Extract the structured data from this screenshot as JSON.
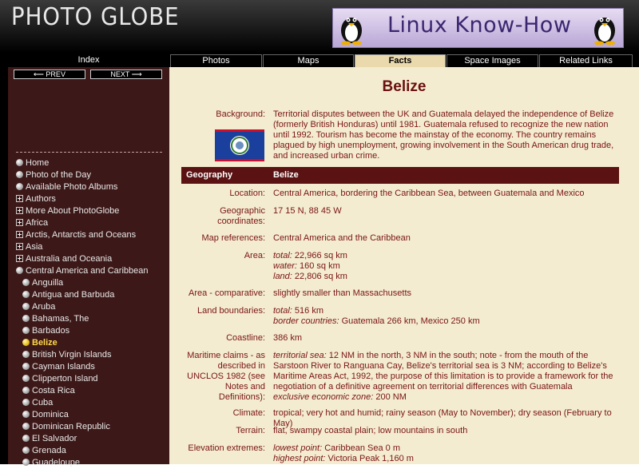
{
  "header": {
    "logo_text": "PHOTO GLOBE",
    "banner_text": "Linux Know-How"
  },
  "nav": {
    "index_label": "Index",
    "prev_label": "⟵ PREV",
    "next_label": "NEXT ⟶",
    "tabs": [
      "Photos",
      "Maps",
      "Facts",
      "Space Images",
      "Related Links"
    ],
    "active_tab": "Facts"
  },
  "sidebar": {
    "items": [
      {
        "label": "Home",
        "marker": "dot"
      },
      {
        "label": "Photo of the Day",
        "marker": "dot"
      },
      {
        "label": "Available Photo Albums",
        "marker": "dot"
      },
      {
        "label": "Authors",
        "marker": "plus"
      },
      {
        "label": "More About PhotoGlobe",
        "marker": "plus"
      },
      {
        "label": "Africa",
        "marker": "plus"
      },
      {
        "label": "Arctis, Antarctis and Oceans",
        "marker": "plus"
      },
      {
        "label": "Asia",
        "marker": "plus"
      },
      {
        "label": "Australia and Oceania",
        "marker": "plus"
      },
      {
        "label": "Central America and Caribbean",
        "marker": "dot"
      },
      {
        "label": "Anguilla",
        "marker": "dot"
      },
      {
        "label": "Antigua and Barbuda",
        "marker": "dot"
      },
      {
        "label": "Aruba",
        "marker": "dot"
      },
      {
        "label": "Bahamas, The",
        "marker": "dot"
      },
      {
        "label": "Barbados",
        "marker": "dot"
      },
      {
        "label": "Belize",
        "marker": "dot"
      },
      {
        "label": "British Virgin Islands",
        "marker": "dot"
      },
      {
        "label": "Cayman Islands",
        "marker": "dot"
      },
      {
        "label": "Clipperton Island",
        "marker": "dot"
      },
      {
        "label": "Costa Rica",
        "marker": "dot"
      },
      {
        "label": "Cuba",
        "marker": "dot"
      },
      {
        "label": "Dominica",
        "marker": "dot"
      },
      {
        "label": "Dominican Republic",
        "marker": "dot"
      },
      {
        "label": "El Salvador",
        "marker": "dot"
      },
      {
        "label": "Grenada",
        "marker": "dot"
      },
      {
        "label": "Guadeloupe",
        "marker": "dot"
      }
    ],
    "current_item": "Belize"
  },
  "content": {
    "title": "Belize",
    "background_label": "Background:",
    "background_text": "Territorial disputes between the UK and Guatemala delayed the independence of Belize (formerly British Honduras) until 1981. Guatemala refused to recognize the new nation until 1992. Tourism has become the mainstay of the economy. The country remains plagued by high unemployment, growing involvement in the South American drug trade, and increased urban crime.",
    "section_label": "Geography",
    "section_value": "Belize",
    "location_label": "Location:",
    "location": "Central America, bordering the Caribbean Sea, between Guatemala and Mexico",
    "coords_label": "Geographic coordinates:",
    "coords": "17 15 N, 88 45 W",
    "mapref_label": "Map references:",
    "mapref": "Central America and the Caribbean",
    "area_label": "Area:",
    "area_total_k": "total:",
    "area_total": " 22,966 sq km",
    "area_water_k": "water:",
    "area_water": " 160 sq km",
    "area_land_k": "land:",
    "area_land": " 22,806 sq km",
    "areacomp_label": "Area - comparative:",
    "areacomp": "slightly smaller than Massachusetts",
    "landb_label": "Land boundaries:",
    "landb_total_k": "total:",
    "landb_total": " 516 km",
    "landb_countries_k": "border countries:",
    "landb_countries": " Guatemala 266 km, Mexico 250 km",
    "coast_label": "Coastline:",
    "coast": "386 km",
    "maritime_label": "Maritime claims - as described in UNCLOS 1982 (see Notes and Definitions):",
    "maritime_ts_k": "territorial sea:",
    "maritime_ts": " 12 NM in the north, 3 NM in the south; note - from the mouth of the Sarstoon River to Ranguana Cay, Belize's territorial sea is 3 NM; according to Belize's Maritime Areas Act, 1992, the purpose of this limitation is to provide a framework for the negotiation of a definitive agreement on territorial differences with Guatemala",
    "maritime_eez_k": "exclusive economic zone:",
    "maritime_eez": " 200 NM",
    "climate_label": "Climate:",
    "climate": "tropical; very hot and humid; rainy season (May to November); dry season (February to May)",
    "terrain_label": "Terrain:",
    "terrain": "flat, swampy coastal plain; low mountains in south",
    "elev_label": "Elevation extremes:",
    "elev_low_k": "lowest point:",
    "elev_low": " Caribbean Sea 0 m",
    "elev_high_k": "highest point:",
    "elev_high": " Victoria Peak 1,160 m"
  },
  "colors": {
    "sidebar_bg": "#3d1818",
    "content_bg": "#f3ecd0",
    "text": "#7a1414",
    "section_bar": "#5b1212",
    "active_tab": "#e9d9ad"
  }
}
